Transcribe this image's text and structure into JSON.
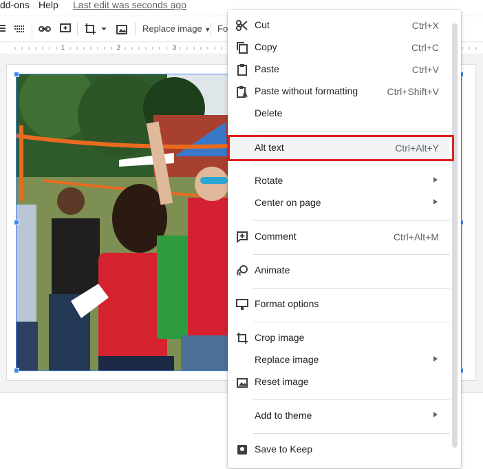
{
  "menubar": {
    "addons": "dd-ons",
    "help": "Help",
    "last_edit": "Last edit was seconds ago"
  },
  "toolbar": {
    "replace_image": "Replace image",
    "format_options": "Fo"
  },
  "ruler": {
    "marks": [
      "1",
      "2",
      "3"
    ]
  },
  "context_menu": {
    "items": [
      {
        "label": "Cut",
        "shortcut": "Ctrl+X",
        "icon": "scissors-icon"
      },
      {
        "label": "Copy",
        "shortcut": "Ctrl+C",
        "icon": "copy-icon"
      },
      {
        "label": "Paste",
        "shortcut": "Ctrl+V",
        "icon": "clipboard-icon"
      },
      {
        "label": "Paste without formatting",
        "shortcut": "Ctrl+Shift+V",
        "icon": "paste-plain-icon"
      },
      {
        "label": "Delete",
        "shortcut": "",
        "icon": ""
      },
      {
        "label": "Alt text",
        "shortcut": "Ctrl+Alt+Y",
        "icon": ""
      },
      {
        "label": "Rotate",
        "shortcut": "",
        "icon": ""
      },
      {
        "label": "Center on page",
        "shortcut": "",
        "icon": ""
      },
      {
        "label": "Comment",
        "shortcut": "Ctrl+Alt+M",
        "icon": "add-comment-icon"
      },
      {
        "label": "Animate",
        "shortcut": "",
        "icon": "animate-icon"
      },
      {
        "label": "Format options",
        "shortcut": "",
        "icon": "format-options-icon"
      },
      {
        "label": "Crop image",
        "shortcut": "",
        "icon": "crop-icon"
      },
      {
        "label": "Replace image",
        "shortcut": "",
        "icon": ""
      },
      {
        "label": "Reset image",
        "shortcut": "",
        "icon": "reset-image-icon"
      },
      {
        "label": "Add to theme",
        "shortcut": "",
        "icon": ""
      },
      {
        "label": "Save to Keep",
        "shortcut": "",
        "icon": "keep-icon"
      }
    ]
  },
  "colors": {
    "accent": "#4285f4",
    "highlight": "#e0201f"
  }
}
